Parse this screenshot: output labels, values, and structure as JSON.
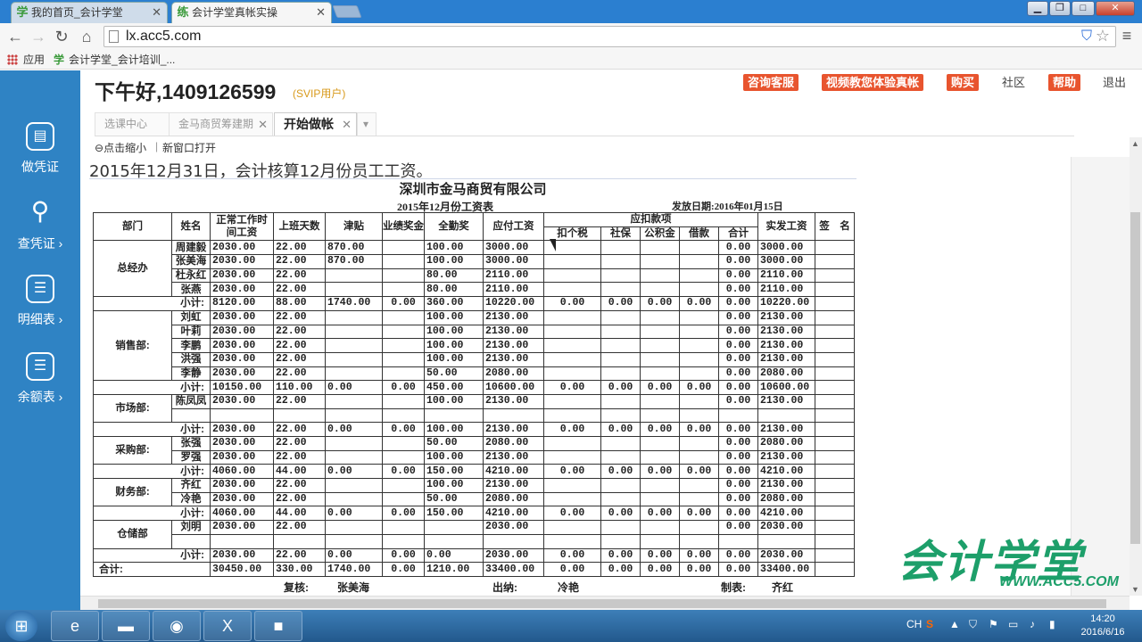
{
  "browser": {
    "tabs": [
      {
        "label": "我的首页_会计学堂",
        "icon": "学"
      },
      {
        "label": "会计学堂真帐实操",
        "icon": "练"
      }
    ],
    "url": "lx.acc5.com",
    "bookmarks": [
      {
        "label": "应用"
      },
      {
        "label": "会计学堂_会计培训_..."
      }
    ]
  },
  "sidebar": {
    "items": [
      {
        "label": "做凭证",
        "icon": "voucher-icon"
      },
      {
        "label": "查凭证 ›",
        "icon": "search-icon"
      },
      {
        "label": "明细表 ›",
        "icon": "list-icon"
      },
      {
        "label": "余额表 ›",
        "icon": "list-icon"
      }
    ]
  },
  "header": {
    "greeting": "下午好,1409126599",
    "vip": "(SVIP用户)",
    "buttons": [
      "咨询客服",
      "视频教您体验真帐",
      "购买",
      "社区",
      "帮助",
      "退出"
    ]
  },
  "tabs": [
    {
      "label": "选课中心"
    },
    {
      "label": "金马商贸筹建期"
    },
    {
      "label": "开始做帐"
    }
  ],
  "toolbar": {
    "shrink": "点击缩小",
    "newwindow": "新窗口打开"
  },
  "task": "2015年12月31日，会计核算12月份员工工资。",
  "sheet": {
    "company": "深圳市金马商贸有限公司",
    "period": "2015年12月份工资表",
    "paydate": "发放日期:2016年01月15日",
    "headers": {
      "dept": "部门",
      "name": "姓名",
      "base": "正常工作时间工资",
      "days": "上班天数",
      "allowance": "津贴",
      "perf": "业绩奖金",
      "attend": "全勤奖",
      "payable": "应付工资",
      "deduct": "应扣款项",
      "tax": "扣个税",
      "social": "社保",
      "fund": "公积金",
      "loan": "借款",
      "total": "合计",
      "actual": "实发工资",
      "sign": "签　名"
    },
    "rows": [
      {
        "type": "emp",
        "dept": "总经办",
        "span": 4,
        "name": "周建毅",
        "base": "2030.00",
        "days": "22.00",
        "allowance": "870.00",
        "perf": "",
        "attend": "100.00",
        "payable": "3000.00",
        "tax": "",
        "social": "",
        "fund": "",
        "loan": "",
        "total": "0.00",
        "actual": "3000.00"
      },
      {
        "type": "emp",
        "name": "张美海",
        "base": "2030.00",
        "days": "22.00",
        "allowance": "870.00",
        "perf": "",
        "attend": "100.00",
        "payable": "3000.00",
        "tax": "",
        "social": "",
        "fund": "",
        "loan": "",
        "total": "0.00",
        "actual": "3000.00"
      },
      {
        "type": "emp",
        "name": "杜永红",
        "base": "2030.00",
        "days": "22.00",
        "allowance": "",
        "perf": "",
        "attend": "80.00",
        "payable": "2110.00",
        "tax": "",
        "social": "",
        "fund": "",
        "loan": "",
        "total": "0.00",
        "actual": "2110.00"
      },
      {
        "type": "emp",
        "name": "张燕",
        "base": "2030.00",
        "days": "22.00",
        "allowance": "",
        "perf": "",
        "attend": "80.00",
        "payable": "2110.00",
        "tax": "",
        "social": "",
        "fund": "",
        "loan": "",
        "total": "0.00",
        "actual": "2110.00"
      },
      {
        "type": "sub",
        "label": "小计:",
        "base": "8120.00",
        "days": "88.00",
        "allowance": "1740.00",
        "perf": "0.00",
        "attend": "360.00",
        "payable": "10220.00",
        "tax": "0.00",
        "social": "0.00",
        "fund": "0.00",
        "loan": "0.00",
        "total": "0.00",
        "actual": "10220.00"
      },
      {
        "type": "emp",
        "dept": "销售部:",
        "span": 5,
        "name": "刘虹",
        "base": "2030.00",
        "days": "22.00",
        "allowance": "",
        "perf": "",
        "attend": "100.00",
        "payable": "2130.00",
        "tax": "",
        "social": "",
        "fund": "",
        "loan": "",
        "total": "0.00",
        "actual": "2130.00"
      },
      {
        "type": "emp",
        "name": "叶莉",
        "base": "2030.00",
        "days": "22.00",
        "allowance": "",
        "perf": "",
        "attend": "100.00",
        "payable": "2130.00",
        "tax": "",
        "social": "",
        "fund": "",
        "loan": "",
        "total": "0.00",
        "actual": "2130.00"
      },
      {
        "type": "emp",
        "name": "李鹏",
        "base": "2030.00",
        "days": "22.00",
        "allowance": "",
        "perf": "",
        "attend": "100.00",
        "payable": "2130.00",
        "tax": "",
        "social": "",
        "fund": "",
        "loan": "",
        "total": "0.00",
        "actual": "2130.00"
      },
      {
        "type": "emp",
        "name": "洪强",
        "base": "2030.00",
        "days": "22.00",
        "allowance": "",
        "perf": "",
        "attend": "100.00",
        "payable": "2130.00",
        "tax": "",
        "social": "",
        "fund": "",
        "loan": "",
        "total": "0.00",
        "actual": "2130.00"
      },
      {
        "type": "emp",
        "name": "李静",
        "base": "2030.00",
        "days": "22.00",
        "allowance": "",
        "perf": "",
        "attend": "50.00",
        "payable": "2080.00",
        "tax": "",
        "social": "",
        "fund": "",
        "loan": "",
        "total": "0.00",
        "actual": "2080.00"
      },
      {
        "type": "sub",
        "label": "小计:",
        "base": "10150.00",
        "days": "110.00",
        "allowance": "0.00",
        "perf": "0.00",
        "attend": "450.00",
        "payable": "10600.00",
        "tax": "0.00",
        "social": "0.00",
        "fund": "0.00",
        "loan": "0.00",
        "total": "0.00",
        "actual": "10600.00"
      },
      {
        "type": "emp",
        "dept": "市场部:",
        "span": 2,
        "name": "陈凤凤",
        "base": "2030.00",
        "days": "22.00",
        "allowance": "",
        "perf": "",
        "attend": "100.00",
        "payable": "2130.00",
        "tax": "",
        "social": "",
        "fund": "",
        "loan": "",
        "total": "0.00",
        "actual": "2130.00"
      },
      {
        "type": "emp",
        "name": "",
        "base": "",
        "days": "",
        "allowance": "",
        "perf": "",
        "attend": "",
        "payable": "",
        "tax": "",
        "social": "",
        "fund": "",
        "loan": "",
        "total": "",
        "actual": ""
      },
      {
        "type": "sub",
        "label": "小计:",
        "base": "2030.00",
        "days": "22.00",
        "allowance": "0.00",
        "perf": "0.00",
        "attend": "100.00",
        "payable": "2130.00",
        "tax": "0.00",
        "social": "0.00",
        "fund": "0.00",
        "loan": "0.00",
        "total": "0.00",
        "actual": "2130.00"
      },
      {
        "type": "emp",
        "dept": "采购部:",
        "span": 2,
        "name": "张强",
        "base": "2030.00",
        "days": "22.00",
        "allowance": "",
        "perf": "",
        "attend": "50.00",
        "payable": "2080.00",
        "tax": "",
        "social": "",
        "fund": "",
        "loan": "",
        "total": "0.00",
        "actual": "2080.00"
      },
      {
        "type": "emp",
        "name": "罗强",
        "base": "2030.00",
        "days": "22.00",
        "allowance": "",
        "perf": "",
        "attend": "100.00",
        "payable": "2130.00",
        "tax": "",
        "social": "",
        "fund": "",
        "loan": "",
        "total": "0.00",
        "actual": "2130.00"
      },
      {
        "type": "sub",
        "label": "小计:",
        "base": "4060.00",
        "days": "44.00",
        "allowance": "0.00",
        "perf": "0.00",
        "attend": "150.00",
        "payable": "4210.00",
        "tax": "0.00",
        "social": "0.00",
        "fund": "0.00",
        "loan": "0.00",
        "total": "0.00",
        "actual": "4210.00"
      },
      {
        "type": "emp",
        "dept": "财务部:",
        "span": 2,
        "name": "齐红",
        "base": "2030.00",
        "days": "22.00",
        "allowance": "",
        "perf": "",
        "attend": "100.00",
        "payable": "2130.00",
        "tax": "",
        "social": "",
        "fund": "",
        "loan": "",
        "total": "0.00",
        "actual": "2130.00"
      },
      {
        "type": "emp",
        "name": "冷艳",
        "base": "2030.00",
        "days": "22.00",
        "allowance": "",
        "perf": "",
        "attend": "50.00",
        "payable": "2080.00",
        "tax": "",
        "social": "",
        "fund": "",
        "loan": "",
        "total": "0.00",
        "actual": "2080.00"
      },
      {
        "type": "sub",
        "label": "小计:",
        "base": "4060.00",
        "days": "44.00",
        "allowance": "0.00",
        "perf": "0.00",
        "attend": "150.00",
        "payable": "4210.00",
        "tax": "0.00",
        "social": "0.00",
        "fund": "0.00",
        "loan": "0.00",
        "total": "0.00",
        "actual": "4210.00"
      },
      {
        "type": "emp",
        "dept": "仓储部",
        "span": 2,
        "name": "刘明",
        "base": "2030.00",
        "days": "22.00",
        "allowance": "",
        "perf": "",
        "attend": "",
        "payable": "2030.00",
        "tax": "",
        "social": "",
        "fund": "",
        "loan": "",
        "total": "0.00",
        "actual": "2030.00"
      },
      {
        "type": "emp",
        "name": "",
        "base": "",
        "days": "",
        "allowance": "",
        "perf": "",
        "attend": "",
        "payable": "",
        "tax": "",
        "social": "",
        "fund": "",
        "loan": "",
        "total": "",
        "actual": ""
      },
      {
        "type": "sub",
        "label": "小计:",
        "base": "2030.00",
        "days": "22.00",
        "allowance": "0.00",
        "perf": "0.00",
        "attend": "0.00",
        "payable": "2030.00",
        "tax": "0.00",
        "social": "0.00",
        "fund": "0.00",
        "loan": "0.00",
        "total": "0.00",
        "actual": "2030.00"
      },
      {
        "type": "grand",
        "label": "合计:",
        "base": "30450.00",
        "days": "330.00",
        "allowance": "1740.00",
        "perf": "0.00",
        "attend": "1210.00",
        "payable": "33400.00",
        "tax": "0.00",
        "social": "0.00",
        "fund": "0.00",
        "loan": "0.00",
        "total": "0.00",
        "actual": "33400.00"
      }
    ],
    "footer": {
      "review_label": "复核:",
      "review": "张美海",
      "cashier_label": "出纳:",
      "cashier": "冷艳",
      "maker_label": "制表:",
      "maker": "齐红"
    }
  },
  "watermark": {
    "big": "会计学堂",
    "small": "WWW.ACC5.COM"
  },
  "taskbar": {
    "apps": [
      "ie-icon",
      "folder-icon",
      "chrome-icon",
      "excel-icon",
      "camera-icon"
    ],
    "lang": "CH",
    "time": "14:20",
    "date": "2016/6/16"
  }
}
